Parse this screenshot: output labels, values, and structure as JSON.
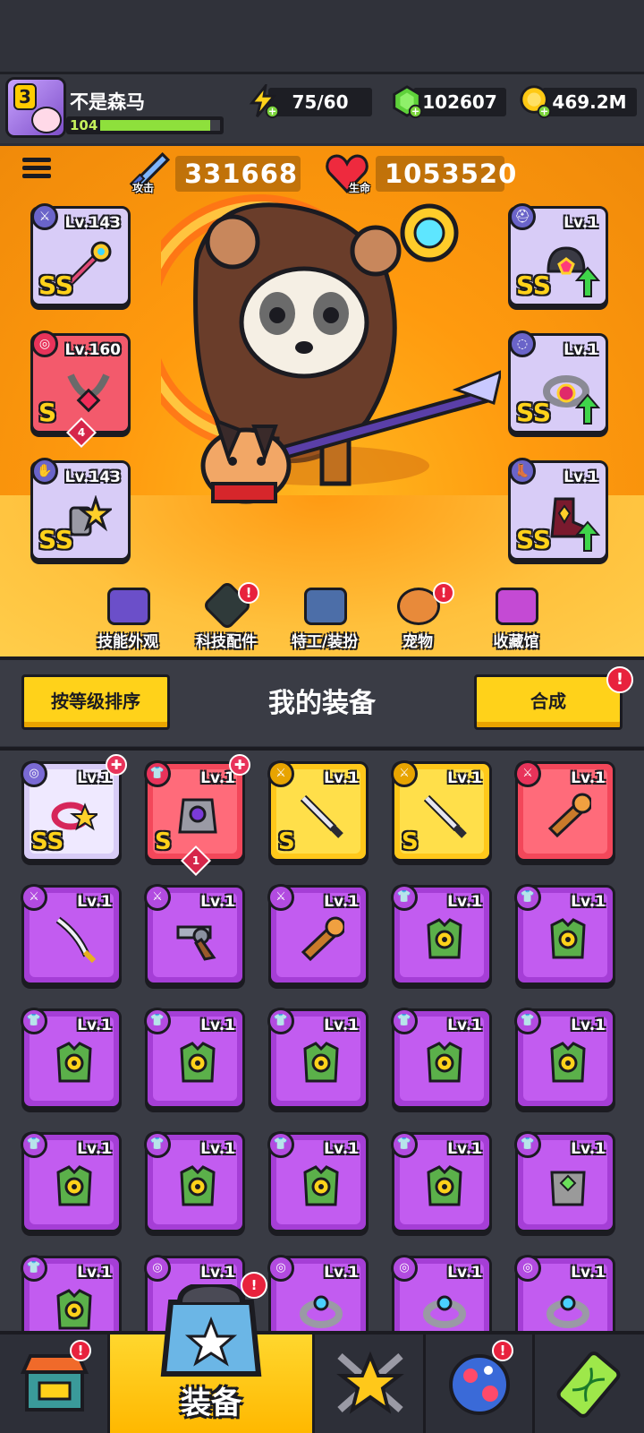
{
  "player": {
    "name": "不是森马",
    "vip_level": "3",
    "level": "104",
    "xp_fraction": 0.92
  },
  "resources": {
    "energy": "75/60",
    "gems": "102607",
    "coins": "469.2M"
  },
  "stats": {
    "attack_value": "331668",
    "attack_label": "攻击",
    "hp_value": "1053520",
    "hp_label": "生命"
  },
  "equipped": {
    "left": [
      {
        "level": "Lv.143",
        "rank": "SS",
        "color": "#d8ccf7"
      },
      {
        "level": "Lv.160",
        "rank": "S",
        "color": "#f35a6c",
        "stars": "4"
      },
      {
        "level": "Lv.143",
        "rank": "SS",
        "color": "#d8ccf7"
      }
    ],
    "right": [
      {
        "level": "Lv.1",
        "rank": "SS",
        "color": "#d8ccf7"
      },
      {
        "level": "Lv.1",
        "rank": "SS",
        "color": "#d8ccf7"
      },
      {
        "level": "Lv.1",
        "rank": "SS",
        "color": "#d8ccf7"
      }
    ]
  },
  "shortcuts": [
    {
      "label": "技能外观",
      "icon": "hat-ball-icon",
      "alert": false
    },
    {
      "label": "科技配件",
      "icon": "tech-chip-icon",
      "alert": true
    },
    {
      "label": "特工/装扮",
      "icon": "agent-mask-icon",
      "alert": false
    },
    {
      "label": "宠物",
      "icon": "shiba-pet-icon",
      "alert": true
    },
    {
      "label": "收藏馆",
      "icon": "treasure-chest-icon",
      "alert": false
    }
  ],
  "panel": {
    "sort_button": "按等级排序",
    "title": "我的装备",
    "merge_button": "合成",
    "merge_alert": "!"
  },
  "inventory": [
    {
      "level": "Lv.1",
      "rank": "SS",
      "tier": "white",
      "item": "collar"
    },
    {
      "level": "Lv.1",
      "rank": "S",
      "tier": "red",
      "item": "armor",
      "stars": "1"
    },
    {
      "level": "Lv.1",
      "rank": "S",
      "tier": "gold",
      "item": "katana"
    },
    {
      "level": "Lv.1",
      "rank": "S",
      "tier": "gold",
      "item": "katana"
    },
    {
      "level": "Lv.1",
      "rank": "",
      "tier": "red",
      "item": "drill"
    },
    {
      "level": "Lv.1",
      "rank": "",
      "tier": "purple",
      "item": "sword"
    },
    {
      "level": "Lv.1",
      "rank": "",
      "tier": "purple",
      "item": "revolver"
    },
    {
      "level": "Lv.1",
      "rank": "",
      "tier": "purple",
      "item": "drill"
    },
    {
      "level": "Lv.1",
      "rank": "",
      "tier": "purple",
      "item": "vest"
    },
    {
      "level": "Lv.1",
      "rank": "",
      "tier": "purple",
      "item": "vest"
    },
    {
      "level": "Lv.1",
      "rank": "",
      "tier": "purple",
      "item": "vest"
    },
    {
      "level": "Lv.1",
      "rank": "",
      "tier": "purple",
      "item": "vest"
    },
    {
      "level": "Lv.1",
      "rank": "",
      "tier": "purple",
      "item": "vest"
    },
    {
      "level": "Lv.1",
      "rank": "",
      "tier": "purple",
      "item": "vest"
    },
    {
      "level": "Lv.1",
      "rank": "",
      "tier": "purple",
      "item": "vest"
    },
    {
      "level": "Lv.1",
      "rank": "",
      "tier": "purple",
      "item": "vest"
    },
    {
      "level": "Lv.1",
      "rank": "",
      "tier": "purple",
      "item": "vest"
    },
    {
      "level": "Lv.1",
      "rank": "",
      "tier": "purple",
      "item": "vest"
    },
    {
      "level": "Lv.1",
      "rank": "",
      "tier": "purple",
      "item": "vest"
    },
    {
      "level": "Lv.1",
      "rank": "",
      "tier": "purple",
      "item": "stone-armor"
    },
    {
      "level": "Lv.1",
      "rank": "",
      "tier": "purple",
      "item": "vest"
    },
    {
      "level": "Lv.1",
      "rank": "",
      "tier": "purple",
      "item": "ring"
    },
    {
      "level": "Lv.1",
      "rank": "",
      "tier": "purple",
      "item": "ring"
    },
    {
      "level": "Lv.1",
      "rank": "",
      "tier": "purple",
      "item": "ring"
    },
    {
      "level": "Lv.1",
      "rank": "",
      "tier": "purple",
      "item": "ring"
    }
  ],
  "nav": [
    {
      "label": "",
      "icon": "shop-icon",
      "alert": true
    },
    {
      "label": "装备",
      "icon": "equipment-icon",
      "alert": true
    },
    {
      "label": "",
      "icon": "star-swords-icon",
      "alert": false
    },
    {
      "label": "",
      "icon": "egg-icon",
      "alert": true
    },
    {
      "label": "",
      "icon": "dna-battery-icon",
      "alert": false
    }
  ],
  "colors": {
    "hero_bg": "#ff9a0e",
    "tier_purple": "#b24be0",
    "tier_gold": "#ffd21a",
    "tier_red": "#f3475a",
    "tier_white": "#d8ccf7"
  }
}
